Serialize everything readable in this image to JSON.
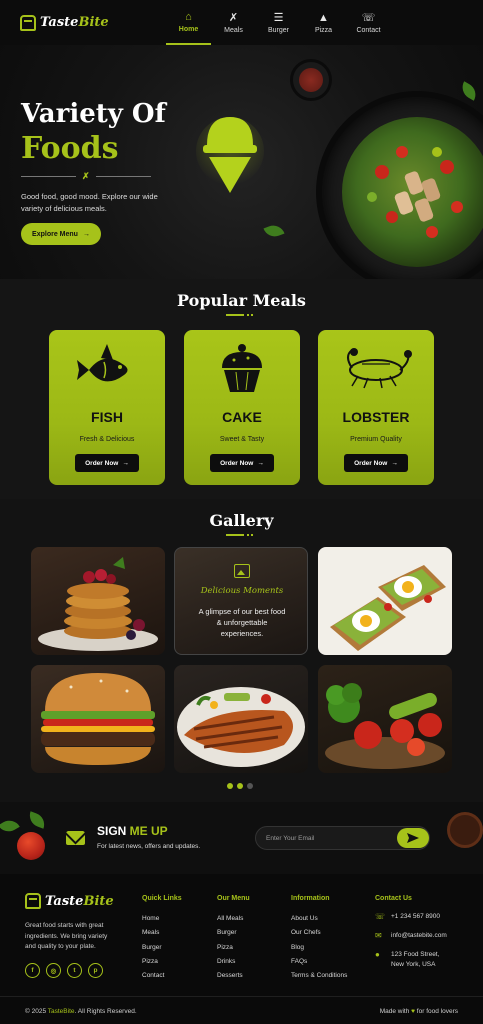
{
  "brand": {
    "name_a": "Taste",
    "name_b": "Bite",
    "accent": "#a6c21a"
  },
  "nav": {
    "items": [
      {
        "label": "Home",
        "icon": "home-icon",
        "active": true
      },
      {
        "label": "Meals",
        "icon": "utensils-icon"
      },
      {
        "label": "Burger",
        "icon": "burger-icon"
      },
      {
        "label": "Pizza",
        "icon": "pizza-icon"
      },
      {
        "label": "Contact",
        "icon": "phone-icon"
      }
    ]
  },
  "hero": {
    "title_line1": "Variety Of",
    "title_line2": "Foods",
    "divider_icon": "utensils-icon",
    "text": "Good food, good mood. Explore our wide variety of delicious meals.",
    "button": "Explore Menu"
  },
  "popular": {
    "title": "Popular Meals",
    "cards": [
      {
        "name": "FISH",
        "sub": "Fresh & Delicious",
        "button": "Order Now",
        "icon": "fish-icon"
      },
      {
        "name": "CAKE",
        "sub": "Sweet & Tasty",
        "button": "Order Now",
        "icon": "cupcake-icon"
      },
      {
        "name": "LOBSTER",
        "sub": "Premium Quality",
        "button": "Order Now",
        "icon": "lobster-icon"
      }
    ]
  },
  "gallery": {
    "title": "Gallery",
    "feature_title": "Delicious Moments",
    "feature_text": "A glimpse of our best food & unforgettable experiences.",
    "images": [
      "pancakes-image",
      "avocado-toast-image",
      "burger-image",
      "grilled-chicken-image",
      "vegetables-image"
    ]
  },
  "signup": {
    "title_a": "SIGN ",
    "title_b": "ME UP",
    "sub": "For latest news, offers and updates.",
    "placeholder": "Enter Your Email"
  },
  "footer": {
    "desc": "Great food starts with great ingredients. We bring variety and quality to your plate.",
    "socials": [
      "f",
      "◎",
      "t",
      "p"
    ],
    "cols": [
      {
        "title": "Quick Links",
        "items": [
          "Home",
          "Meals",
          "Burger",
          "Pizza",
          "Contact"
        ]
      },
      {
        "title": "Our Menu",
        "items": [
          "All Meals",
          "Burger",
          "Pizza",
          "Drinks",
          "Desserts"
        ]
      },
      {
        "title": "Information",
        "items": [
          "About Us",
          "Our Chefs",
          "Blog",
          "FAQs",
          "Terms & Conditions"
        ]
      }
    ],
    "contact": {
      "title": "Contact Us",
      "phone": "+1 234 567 8900",
      "email": "info@tastebite.com",
      "address1": "123 Food Street,",
      "address2": "New York, USA"
    },
    "copy_a": "© 2025 ",
    "copy_b": "TasteBite",
    "copy_c": ". All Rights Reserved.",
    "made_a": "Made with ",
    "made_b": " for food lovers"
  }
}
